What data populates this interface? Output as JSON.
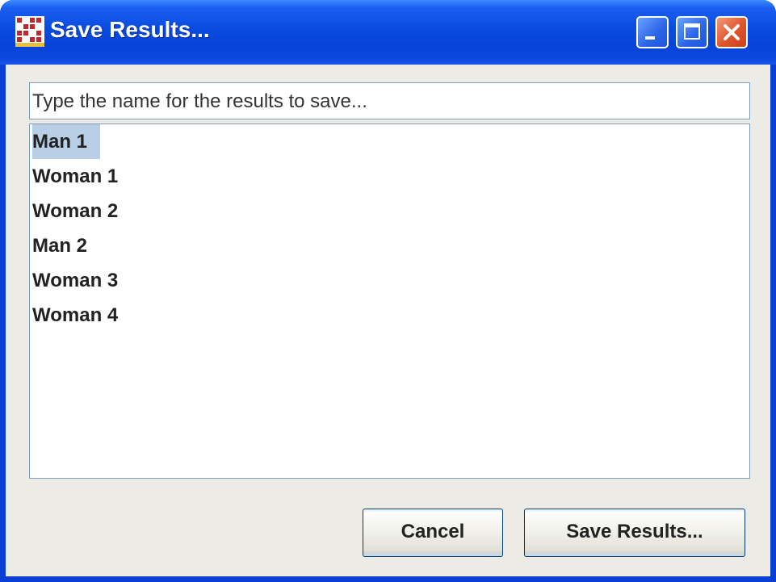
{
  "window": {
    "title": "Save Results...",
    "icon": "app-grid-icon",
    "controls": [
      "minimize-icon",
      "maximize-icon",
      "close-icon"
    ]
  },
  "name_input": {
    "placeholder": "Type the name for the results to save..."
  },
  "results_list": {
    "items": [
      {
        "label": "Man 1",
        "selected": true
      },
      {
        "label": "Woman 1",
        "selected": false
      },
      {
        "label": "Woman 2",
        "selected": false
      },
      {
        "label": "Man 2",
        "selected": false
      },
      {
        "label": "Woman 3",
        "selected": false
      },
      {
        "label": "Woman 4",
        "selected": false
      }
    ]
  },
  "buttons": {
    "cancel_label": "Cancel",
    "save_label": "Save Results..."
  },
  "colors": {
    "titlebar": "#0a4bdf",
    "selection": "#b8cfe5",
    "close_button": "#e0542c"
  }
}
